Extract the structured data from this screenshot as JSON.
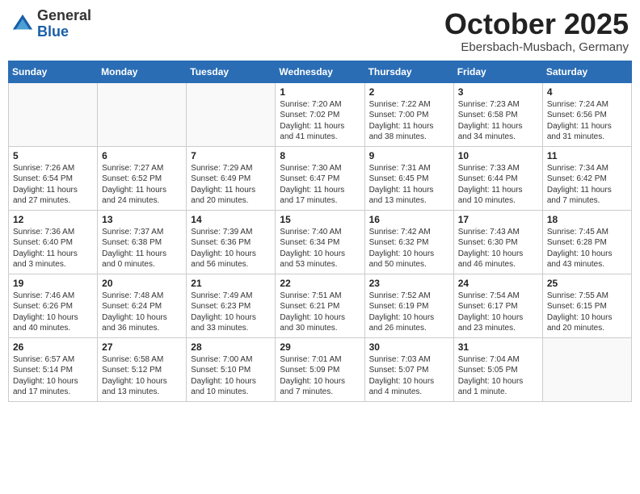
{
  "header": {
    "logo": {
      "general": "General",
      "blue": "Blue"
    },
    "title": "October 2025",
    "subtitle": "Ebersbach-Musbach, Germany"
  },
  "days_of_week": [
    "Sunday",
    "Monday",
    "Tuesday",
    "Wednesday",
    "Thursday",
    "Friday",
    "Saturday"
  ],
  "weeks": [
    [
      {
        "day": "",
        "info": ""
      },
      {
        "day": "",
        "info": ""
      },
      {
        "day": "",
        "info": ""
      },
      {
        "day": "1",
        "info": "Sunrise: 7:20 AM\nSunset: 7:02 PM\nDaylight: 11 hours and 41 minutes."
      },
      {
        "day": "2",
        "info": "Sunrise: 7:22 AM\nSunset: 7:00 PM\nDaylight: 11 hours and 38 minutes."
      },
      {
        "day": "3",
        "info": "Sunrise: 7:23 AM\nSunset: 6:58 PM\nDaylight: 11 hours and 34 minutes."
      },
      {
        "day": "4",
        "info": "Sunrise: 7:24 AM\nSunset: 6:56 PM\nDaylight: 11 hours and 31 minutes."
      }
    ],
    [
      {
        "day": "5",
        "info": "Sunrise: 7:26 AM\nSunset: 6:54 PM\nDaylight: 11 hours and 27 minutes."
      },
      {
        "day": "6",
        "info": "Sunrise: 7:27 AM\nSunset: 6:52 PM\nDaylight: 11 hours and 24 minutes."
      },
      {
        "day": "7",
        "info": "Sunrise: 7:29 AM\nSunset: 6:49 PM\nDaylight: 11 hours and 20 minutes."
      },
      {
        "day": "8",
        "info": "Sunrise: 7:30 AM\nSunset: 6:47 PM\nDaylight: 11 hours and 17 minutes."
      },
      {
        "day": "9",
        "info": "Sunrise: 7:31 AM\nSunset: 6:45 PM\nDaylight: 11 hours and 13 minutes."
      },
      {
        "day": "10",
        "info": "Sunrise: 7:33 AM\nSunset: 6:44 PM\nDaylight: 11 hours and 10 minutes."
      },
      {
        "day": "11",
        "info": "Sunrise: 7:34 AM\nSunset: 6:42 PM\nDaylight: 11 hours and 7 minutes."
      }
    ],
    [
      {
        "day": "12",
        "info": "Sunrise: 7:36 AM\nSunset: 6:40 PM\nDaylight: 11 hours and 3 minutes."
      },
      {
        "day": "13",
        "info": "Sunrise: 7:37 AM\nSunset: 6:38 PM\nDaylight: 11 hours and 0 minutes."
      },
      {
        "day": "14",
        "info": "Sunrise: 7:39 AM\nSunset: 6:36 PM\nDaylight: 10 hours and 56 minutes."
      },
      {
        "day": "15",
        "info": "Sunrise: 7:40 AM\nSunset: 6:34 PM\nDaylight: 10 hours and 53 minutes."
      },
      {
        "day": "16",
        "info": "Sunrise: 7:42 AM\nSunset: 6:32 PM\nDaylight: 10 hours and 50 minutes."
      },
      {
        "day": "17",
        "info": "Sunrise: 7:43 AM\nSunset: 6:30 PM\nDaylight: 10 hours and 46 minutes."
      },
      {
        "day": "18",
        "info": "Sunrise: 7:45 AM\nSunset: 6:28 PM\nDaylight: 10 hours and 43 minutes."
      }
    ],
    [
      {
        "day": "19",
        "info": "Sunrise: 7:46 AM\nSunset: 6:26 PM\nDaylight: 10 hours and 40 minutes."
      },
      {
        "day": "20",
        "info": "Sunrise: 7:48 AM\nSunset: 6:24 PM\nDaylight: 10 hours and 36 minutes."
      },
      {
        "day": "21",
        "info": "Sunrise: 7:49 AM\nSunset: 6:23 PM\nDaylight: 10 hours and 33 minutes."
      },
      {
        "day": "22",
        "info": "Sunrise: 7:51 AM\nSunset: 6:21 PM\nDaylight: 10 hours and 30 minutes."
      },
      {
        "day": "23",
        "info": "Sunrise: 7:52 AM\nSunset: 6:19 PM\nDaylight: 10 hours and 26 minutes."
      },
      {
        "day": "24",
        "info": "Sunrise: 7:54 AM\nSunset: 6:17 PM\nDaylight: 10 hours and 23 minutes."
      },
      {
        "day": "25",
        "info": "Sunrise: 7:55 AM\nSunset: 6:15 PM\nDaylight: 10 hours and 20 minutes."
      }
    ],
    [
      {
        "day": "26",
        "info": "Sunrise: 6:57 AM\nSunset: 5:14 PM\nDaylight: 10 hours and 17 minutes."
      },
      {
        "day": "27",
        "info": "Sunrise: 6:58 AM\nSunset: 5:12 PM\nDaylight: 10 hours and 13 minutes."
      },
      {
        "day": "28",
        "info": "Sunrise: 7:00 AM\nSunset: 5:10 PM\nDaylight: 10 hours and 10 minutes."
      },
      {
        "day": "29",
        "info": "Sunrise: 7:01 AM\nSunset: 5:09 PM\nDaylight: 10 hours and 7 minutes."
      },
      {
        "day": "30",
        "info": "Sunrise: 7:03 AM\nSunset: 5:07 PM\nDaylight: 10 hours and 4 minutes."
      },
      {
        "day": "31",
        "info": "Sunrise: 7:04 AM\nSunset: 5:05 PM\nDaylight: 10 hours and 1 minute."
      },
      {
        "day": "",
        "info": ""
      }
    ]
  ]
}
